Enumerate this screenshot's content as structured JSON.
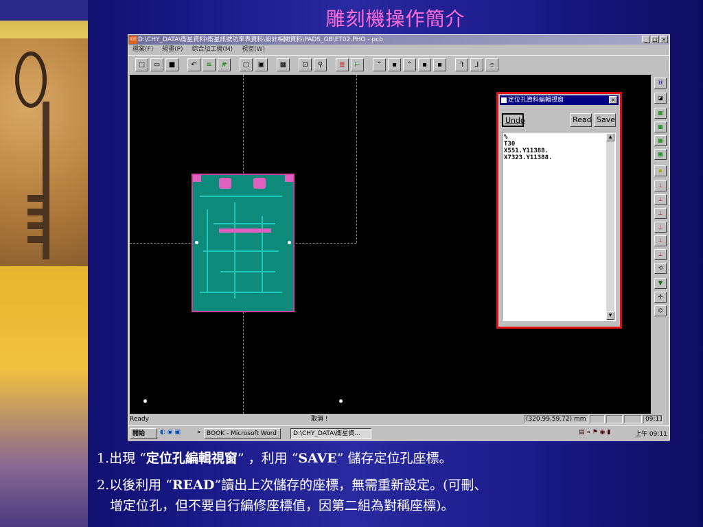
{
  "slide": {
    "title": "雕刻機操作簡介",
    "line1_pre": "1.出現 “",
    "line1_bold1": "定位孔編輯視窗",
    "line1_mid": "” ，利用 “",
    "line1_bold2": "SAVE",
    "line1_post": "” 儲存定位孔座標。",
    "line2_pre": "2.以後利用 “",
    "line2_bold": "READ",
    "line2_post": "”讀出上次儲存的座標，無需重新設定。(可刪、",
    "line3": "增定位孔，但不要自行編修座標值，因第二組為對稱座標)。"
  },
  "window": {
    "app_icon": "IGE",
    "title": "D:\\CHY_DATA\\衛星資料\\衛星訊號功率表資料\\設計相關資料\\PADS_GB\\ET02.PHO - pcb",
    "buttons": [
      "_",
      "□",
      "×"
    ],
    "menu": [
      "檔案(F)",
      "規畫(P)",
      "綜合加工機(M)",
      "視窗(W)"
    ]
  },
  "dialog": {
    "title": "定位孔資料編輯視窗",
    "close": "×",
    "undo": "Undo",
    "read": "Read",
    "save": "Save",
    "content": "%\nT30\nX551.Y11388.\nX7323.Y11388."
  },
  "statusbar": {
    "ready": "Ready",
    "cancel": "取消 !",
    "coords": "(320.99,59.72) mm",
    "time": "09:11:"
  },
  "taskbar": {
    "start": "開始",
    "more": "»",
    "task1": "BOOK - Microsoft Word",
    "task2": "D:\\CHY_DATA\\衛星資...",
    "tray_time": "上午 09:11"
  },
  "colors": {
    "title": "#ff6ad5",
    "dialog_highlight": "#e01010",
    "pcb": "#0e8a7a"
  }
}
